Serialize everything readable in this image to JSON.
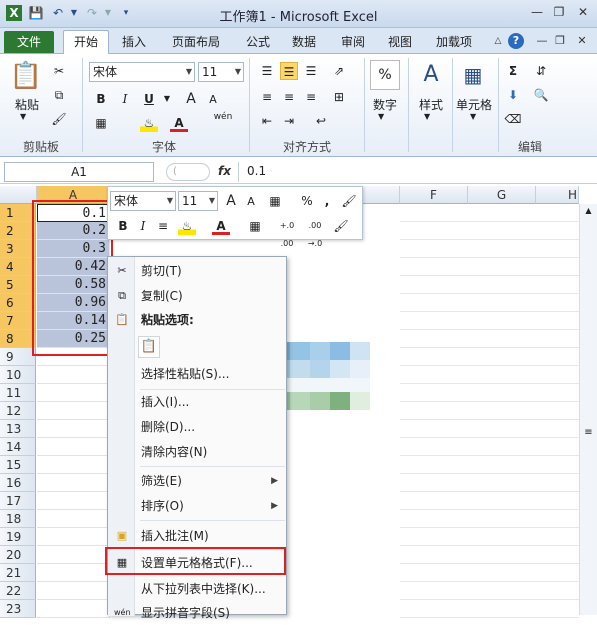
{
  "window": {
    "title": "工作簿1 - Microsoft Excel"
  },
  "tabs": {
    "file": "文件",
    "home": "开始",
    "insert": "插入",
    "layout": "页面布局",
    "formulas": "公式",
    "data": "数据",
    "review": "审阅",
    "view": "视图",
    "addins": "加载项"
  },
  "ribbon": {
    "clipboard": {
      "label": "剪贴板",
      "paste": "粘贴"
    },
    "font": {
      "label": "字体",
      "name": "宋体",
      "size": "11",
      "bold": "B",
      "italic": "I",
      "underline": "U",
      "grow": "A",
      "shrink": "A",
      "wen": "wén"
    },
    "alignment": {
      "label": "对齐方式"
    },
    "number": {
      "label": "数字",
      "percent": "%"
    },
    "styles": {
      "label": "样式"
    },
    "cells": {
      "label": "单元格"
    },
    "editing": {
      "label": "编辑",
      "sigma": "Σ"
    }
  },
  "formula_bar": {
    "name_box": "A1",
    "fx": "fx",
    "value": "0.1"
  },
  "sheet": {
    "columns": [
      "A",
      "F",
      "G",
      "H"
    ],
    "rows": [
      "1",
      "2",
      "3",
      "4",
      "5",
      "6",
      "7",
      "8",
      "9",
      "10",
      "11",
      "12",
      "13",
      "14",
      "15",
      "16",
      "17",
      "18",
      "19",
      "20",
      "21",
      "22",
      "23"
    ],
    "colA_values": [
      "0.1",
      "0.2",
      "0.3",
      "0.42",
      "0.58",
      "0.96",
      "0.14",
      "0.25"
    ]
  },
  "mini_toolbar": {
    "font": "宋体",
    "size": "11",
    "bold": "B",
    "italic": "I",
    "percent": "%",
    "comma": ",",
    "inc_dec": "+.0 .00",
    "dec_dec": ".00 →.0"
  },
  "context_menu": {
    "cut": "剪切(T)",
    "copy": "复制(C)",
    "paste_options": "粘贴选项:",
    "paste_special": "选择性粘贴(S)...",
    "insert": "插入(I)...",
    "delete": "删除(D)...",
    "clear": "清除内容(N)",
    "filter": "筛选(E)",
    "sort": "排序(O)",
    "insert_comment": "插入批注(M)",
    "format_cells": "设置单元格格式(F)...",
    "pick_from_list": "从下拉列表中选择(K)...",
    "phonetic": "显示拼音字段(S)"
  },
  "colors": {
    "accent_green": "#2c7a32",
    "highlight_red": "#e02020",
    "selection": "#b9c3d9",
    "row_header_selected": "#f6c760"
  }
}
